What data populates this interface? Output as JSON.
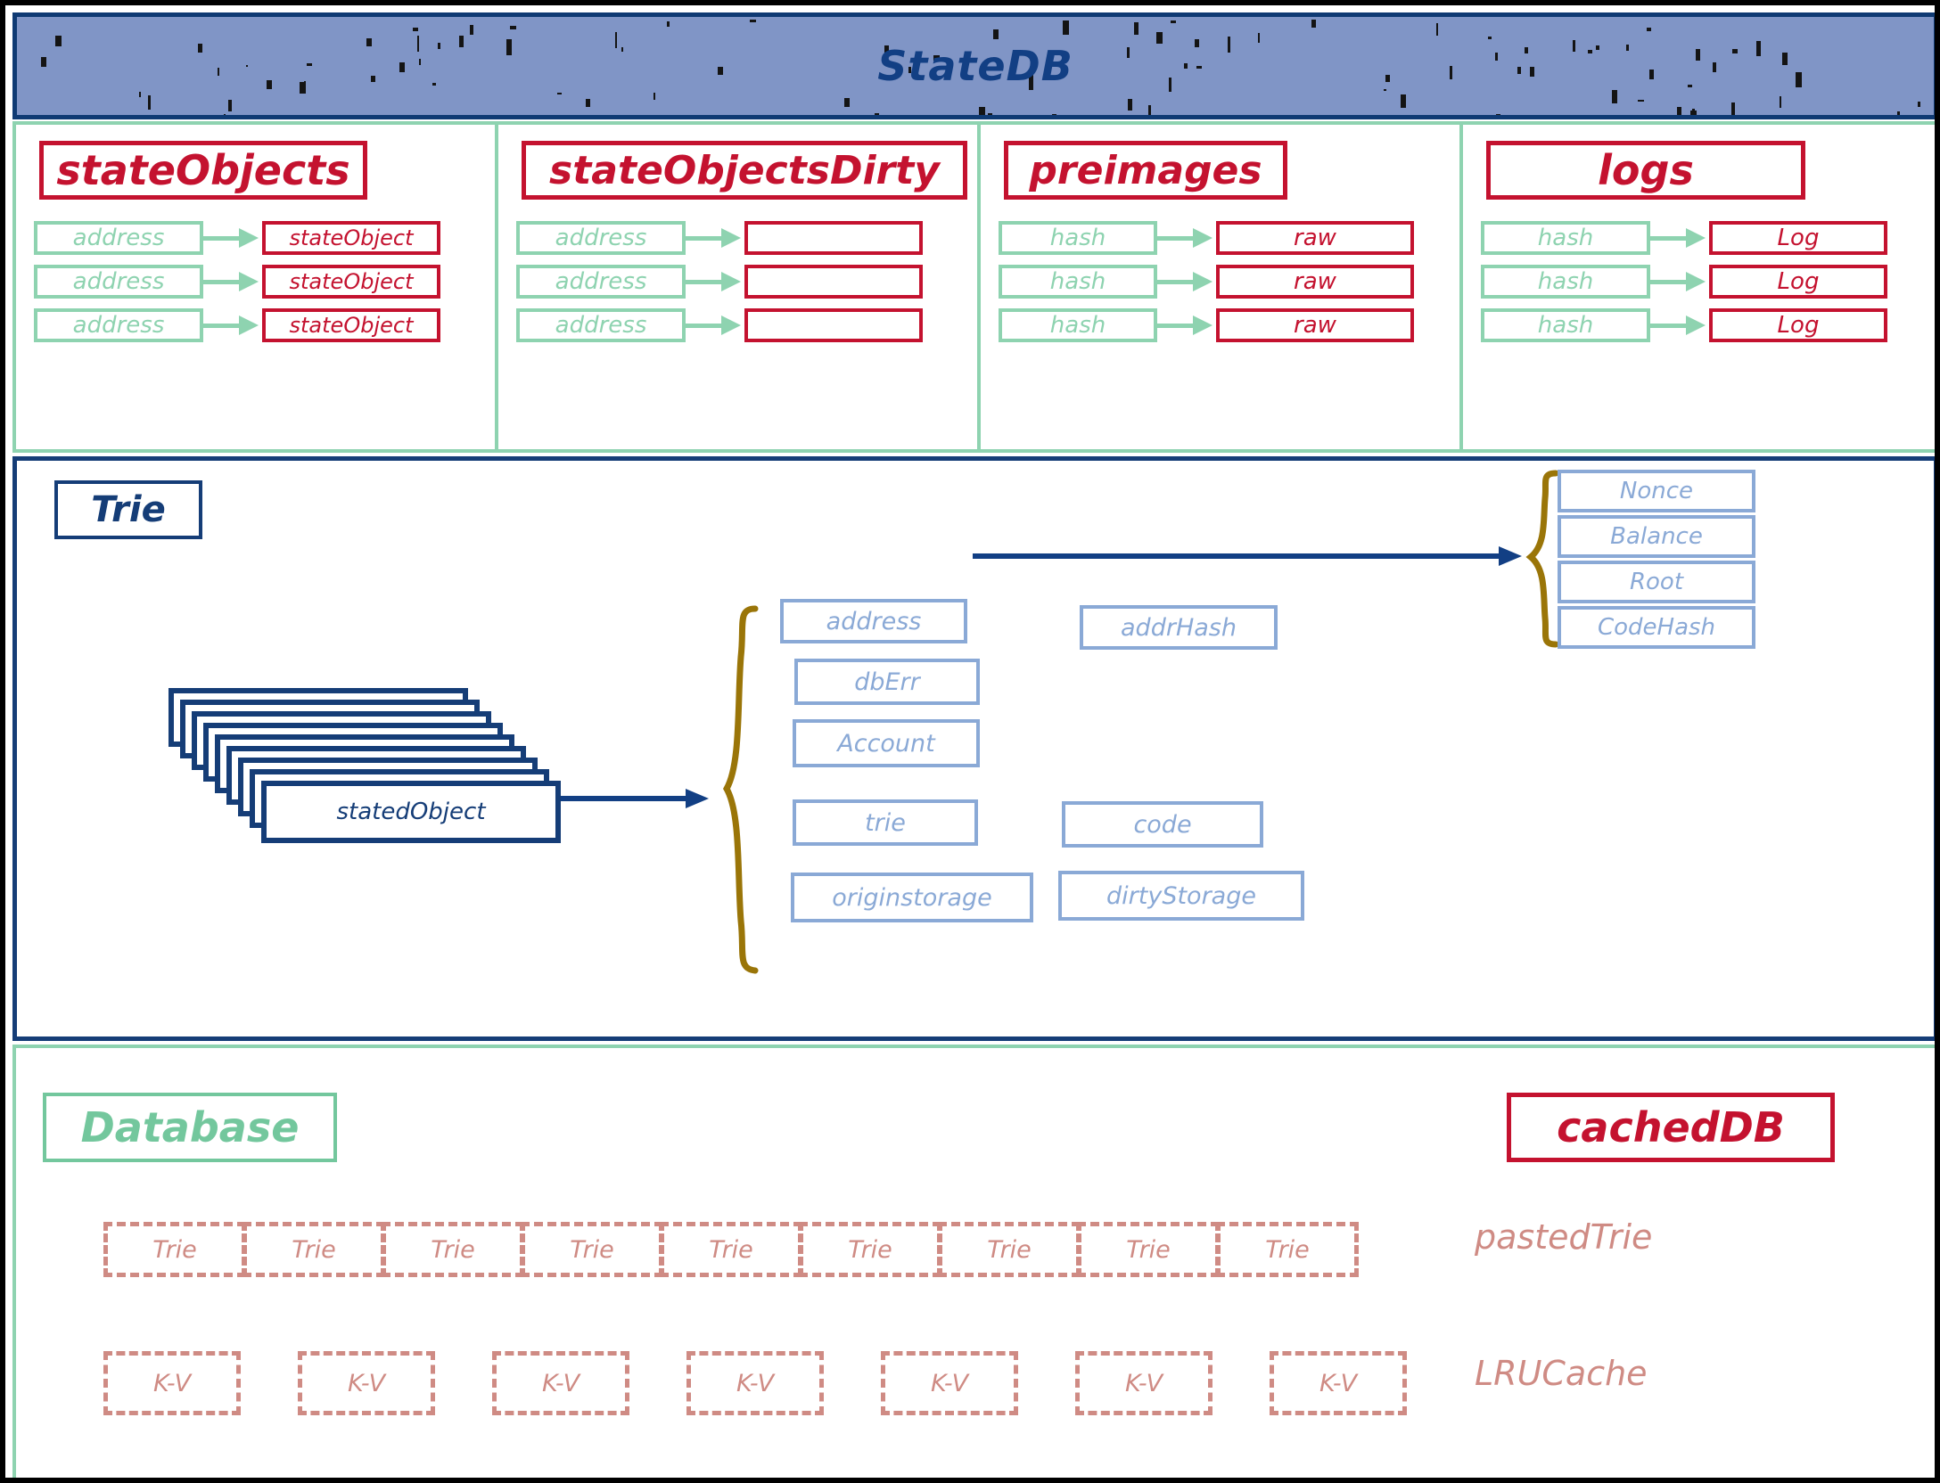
{
  "header": {
    "title": "StateDB",
    "bg_color": "#8095c6",
    "border_color": "#0f3a73",
    "text_color": "#123f84"
  },
  "colors": {
    "red": "#c4122f",
    "green": "#8ed3b0",
    "navy": "#153d77",
    "light_blue": "#8aa9d6",
    "olive": "#9a7508",
    "rose": "#cf8b84"
  },
  "maps": [
    {
      "title": "stateObjects",
      "rows": [
        {
          "key": "address",
          "value": "stateObject"
        },
        {
          "key": "address",
          "value": "stateObject"
        },
        {
          "key": "address",
          "value": "stateObject"
        }
      ]
    },
    {
      "title": "stateObjectsDirty",
      "rows": [
        {
          "key": "address",
          "value": ""
        },
        {
          "key": "address",
          "value": ""
        },
        {
          "key": "address",
          "value": ""
        }
      ]
    },
    {
      "title": "preimages",
      "rows": [
        {
          "key": "hash",
          "value": "raw"
        },
        {
          "key": "hash",
          "value": "raw"
        },
        {
          "key": "hash",
          "value": "raw"
        }
      ]
    },
    {
      "title": "logs",
      "rows": [
        {
          "key": "hash",
          "value": "Log"
        },
        {
          "key": "hash",
          "value": "Log"
        },
        {
          "key": "hash",
          "value": "Log"
        }
      ]
    }
  ],
  "trie": {
    "title": "Trie",
    "stack_label": "statedObject",
    "stack_count": 9,
    "fields": [
      {
        "name": "address"
      },
      {
        "name": "addrHash"
      },
      {
        "name": "dbErr"
      },
      {
        "name": "Account"
      },
      {
        "name": "trie"
      },
      {
        "name": "code"
      },
      {
        "name": "originstorage"
      },
      {
        "name": "dirtyStorage"
      }
    ],
    "account_fields": [
      {
        "name": "Nonce"
      },
      {
        "name": "Balance"
      },
      {
        "name": "Root"
      },
      {
        "name": "CodeHash"
      }
    ]
  },
  "database": {
    "title": "Database",
    "cached_db_title": "cachedDB",
    "pasted_trie_label": "pastedTrie",
    "lru_cache_label": "LRUCache",
    "trie_cells": [
      "Trie",
      "Trie",
      "Trie",
      "Trie",
      "Trie",
      "Trie",
      "Trie",
      "Trie",
      "Trie"
    ],
    "kv_cells": [
      "K-V",
      "K-V",
      "K-V",
      "K-V",
      "K-V",
      "K-V",
      "K-V"
    ]
  }
}
